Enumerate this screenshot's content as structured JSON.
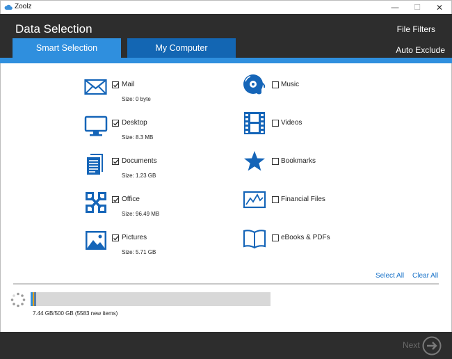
{
  "window": {
    "app_title": "Zoolz",
    "controls": {
      "minimize": "—",
      "maximize": "☐",
      "close": "✕"
    }
  },
  "header": {
    "title": "Data Selection",
    "file_filters": "File Filters",
    "auto_exclude": "Auto Exclude",
    "tabs": [
      {
        "label": "Smart Selection",
        "active": true
      },
      {
        "label": "My Computer",
        "active": false
      }
    ]
  },
  "categories_left": [
    {
      "label": "Mail",
      "size": "Size: 0 byte",
      "checked": true,
      "icon": "mail-icon"
    },
    {
      "label": "Desktop",
      "size": "Size: 8.3 MB",
      "checked": true,
      "icon": "desktop-icon"
    },
    {
      "label": "Documents",
      "size": "Size: 1.23 GB",
      "checked": true,
      "icon": "documents-icon"
    },
    {
      "label": "Office",
      "size": "Size: 96.49 MB",
      "checked": true,
      "icon": "office-icon"
    },
    {
      "label": "Pictures",
      "size": "Size: 5.71 GB",
      "checked": true,
      "icon": "pictures-icon"
    }
  ],
  "categories_right": [
    {
      "label": "Music",
      "checked": false,
      "icon": "music-icon"
    },
    {
      "label": "Videos",
      "checked": false,
      "icon": "videos-icon"
    },
    {
      "label": "Bookmarks",
      "checked": false,
      "icon": "bookmarks-icon"
    },
    {
      "label": "Financial Files",
      "checked": false,
      "icon": "financial-files-icon"
    },
    {
      "label": "eBooks & PDFs",
      "checked": false,
      "icon": "ebooks-icon"
    }
  ],
  "selection": {
    "select_all": "Select All",
    "clear_all": "Clear All"
  },
  "storage": {
    "label": "7.44 GB/500 GB (5583 new items)",
    "used_gb": 7.44,
    "total_gb": 500
  },
  "footer": {
    "next": "Next"
  },
  "colors": {
    "accent": "#2f8fde",
    "tab_inactive": "#1366b3",
    "dark": "#2d2d2d",
    "icon_blue": "#1565b8",
    "link": "#1a73c9"
  }
}
